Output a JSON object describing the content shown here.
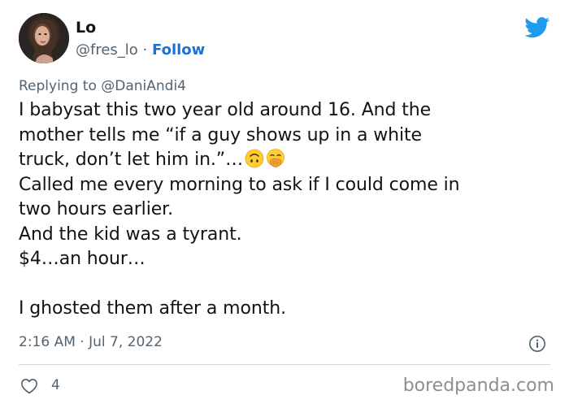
{
  "user": {
    "name": "Lo",
    "handle": "@fres_lo",
    "separator": "·",
    "follow_label": "Follow",
    "avatar_icon": "profile-photo"
  },
  "reply": {
    "prefix": "Replying to",
    "to_handle": "@DaniAndi4"
  },
  "tweet": {
    "lines": [
      "I babysat this two year old around 16. And the",
      "mother tells me “if a guy shows up in a white",
      "truck, don’t let him in.”…",
      "Called me every morning to ask if I could come in",
      "two hours earlier.",
      "And the kid was a tyrant.",
      "$4…an hour…",
      "",
      "I ghosted them after a month."
    ],
    "emojis": [
      "upside-down-face",
      "face-with-hand-over-mouth"
    ]
  },
  "meta": {
    "timestamp": "2:16 AM · Jul 7, 2022",
    "likes": "4",
    "info_icon": "info-icon",
    "like_icon": "heart-icon"
  },
  "brand": {
    "platform_icon": "twitter-bird-icon",
    "twitter_blue": "#1d9bf0",
    "watermark": "boredpanda.com"
  },
  "colors": {
    "text": "#0f1419",
    "muted": "#536471",
    "link": "#1b72d1",
    "divider": "#cfd9de"
  }
}
